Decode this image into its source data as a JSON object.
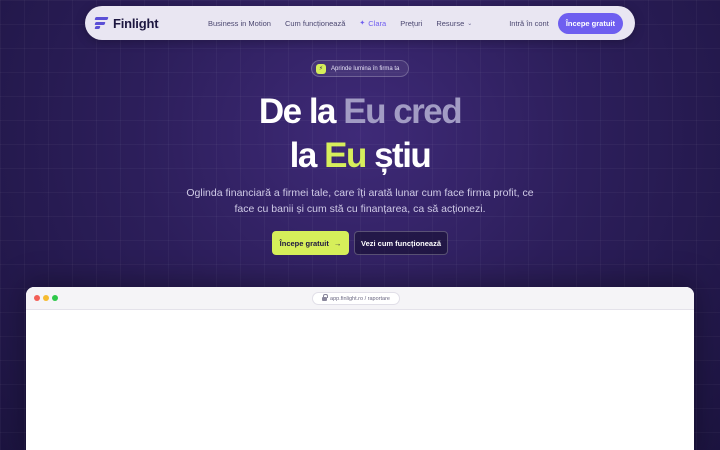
{
  "nav": {
    "brand": "Finlight",
    "links": [
      {
        "label": "Business in Motion"
      },
      {
        "label": "Cum funcționează"
      },
      {
        "label": "Clara"
      },
      {
        "label": "Prețuri"
      },
      {
        "label": "Resurse"
      }
    ],
    "login": "Intră în cont",
    "cta": "Începe gratuit"
  },
  "badge": {
    "text": "Aprinde lumina în firma ta"
  },
  "hero": {
    "line1_a": "De la",
    "line1_b": "Eu cred",
    "line2_a": "la",
    "line2_b": "Eu",
    "line2_c": "știu",
    "subtitle": "Oglinda financiară a firmei tale, care îți arată lunar cum face firma profit, ce face cu banii și cum stă cu finanțarea, ca să acționezi.",
    "primary_cta": "Începe gratuit",
    "secondary_cta": "Vezi cum funcționează"
  },
  "browser": {
    "url": "app.finlight.ro / raportare"
  },
  "icons": {
    "brand": "finlight-logo-icon",
    "clara": "sparkle-icon",
    "resurse": "chevron-down-icon",
    "badge": "bolt-icon",
    "cta": "arrow-right-icon",
    "url": "lock-icon"
  },
  "colors": {
    "accent": "#6e5ef0",
    "lime": "#d6ef5a",
    "background": "#2c1e5a",
    "nav_bg": "#e9e6f2"
  }
}
